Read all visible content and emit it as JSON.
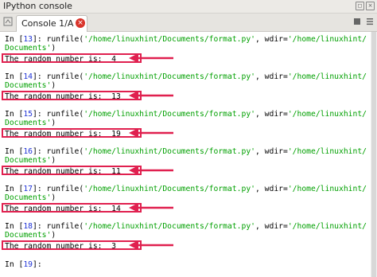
{
  "window": {
    "title": "IPython console"
  },
  "tab": {
    "label": "Console 1/A",
    "close_glyph": "×"
  },
  "console": {
    "blocks": [
      {
        "prompt": "In [",
        "num": "13",
        "prompt_end": "]: ",
        "cmd": "runfile(",
        "path1": "'/home/linuxhint/Documents/format.py'",
        "sep": ", wdir=",
        "path2": "'/home/linuxhint/",
        "cont": "Documents'",
        "close": ")",
        "output": "The random number is:  4"
      },
      {
        "prompt": "In [",
        "num": "14",
        "prompt_end": "]: ",
        "cmd": "runfile(",
        "path1": "'/home/linuxhint/Documents/format.py'",
        "sep": ", wdir=",
        "path2": "'/home/linuxhint/",
        "cont": "Documents'",
        "close": ")",
        "output": "The random number is:  13"
      },
      {
        "prompt": "In [",
        "num": "15",
        "prompt_end": "]: ",
        "cmd": "runfile(",
        "path1": "'/home/linuxhint/Documents/format.py'",
        "sep": ", wdir=",
        "path2": "'/home/linuxhint/",
        "cont": "Documents'",
        "close": ")",
        "output": "The random number is:  19"
      },
      {
        "prompt": "In [",
        "num": "16",
        "prompt_end": "]: ",
        "cmd": "runfile(",
        "path1": "'/home/linuxhint/Documents/format.py'",
        "sep": ", wdir=",
        "path2": "'/home/linuxhint/",
        "cont": "Documents'",
        "close": ")",
        "output": "The random number is:  11"
      },
      {
        "prompt": "In [",
        "num": "17",
        "prompt_end": "]: ",
        "cmd": "runfile(",
        "path1": "'/home/linuxhint/Documents/format.py'",
        "sep": ", wdir=",
        "path2": "'/home/linuxhint/",
        "cont": "Documents'",
        "close": ")",
        "output": "The random number is:  14"
      },
      {
        "prompt": "In [",
        "num": "18",
        "prompt_end": "]: ",
        "cmd": "runfile(",
        "path1": "'/home/linuxhint/Documents/format.py'",
        "sep": ", wdir=",
        "path2": "'/home/linuxhint/",
        "cont": "Documents'",
        "close": ")",
        "output": "The random number is:  3"
      }
    ],
    "final_prompt": {
      "prompt": "In [",
      "num": "19",
      "prompt_end": "]:"
    }
  },
  "colors": {
    "prompt_number": "#1f33d6",
    "string": "#00a000",
    "highlight": "#e0204f",
    "close_button": "#d9342b"
  },
  "icons": [
    "new-console-icon",
    "close-tab-icon",
    "stop-icon",
    "options-icon",
    "undock-icon",
    "close-pane-icon"
  ]
}
